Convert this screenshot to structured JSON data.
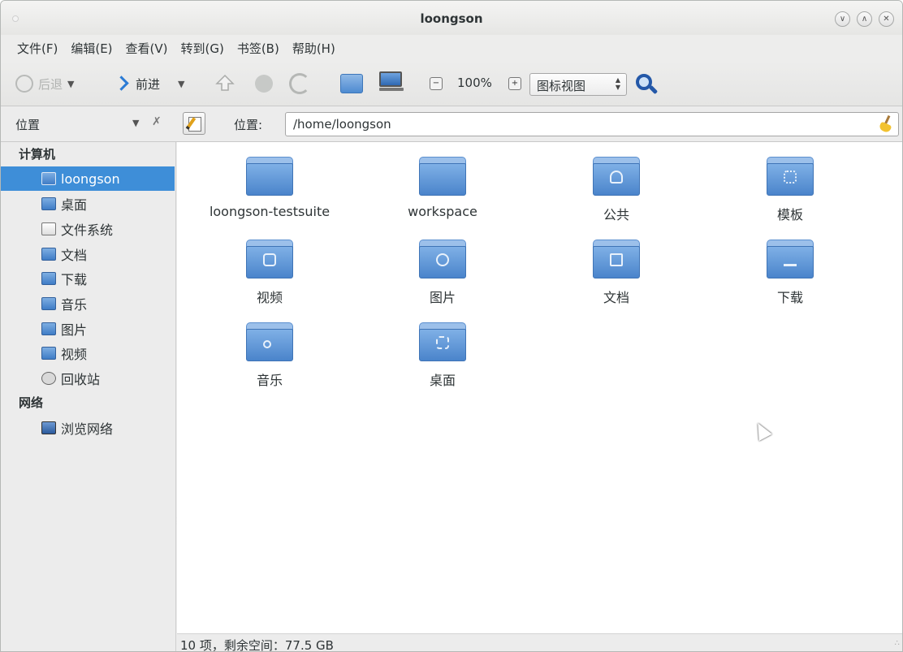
{
  "window": {
    "title": "loongson"
  },
  "menu": [
    "文件(F)",
    "编辑(E)",
    "查看(V)",
    "转到(G)",
    "书签(B)",
    "帮助(H)"
  ],
  "toolbar": {
    "back_label": "后退",
    "forward_label": "前进",
    "zoom_level": "100%",
    "view_mode": "图标视图"
  },
  "location": {
    "sidebar_header": "位置",
    "label": "位置:",
    "path": "/home/loongson"
  },
  "sidebar": {
    "section_computer": "计算机",
    "items": [
      {
        "label": "loongson",
        "icon": "home-folder-icon",
        "selected": true
      },
      {
        "label": "桌面",
        "icon": "desktop-folder-icon"
      },
      {
        "label": "文件系统",
        "icon": "filesystem-icon"
      },
      {
        "label": "文档",
        "icon": "documents-folder-icon"
      },
      {
        "label": "下载",
        "icon": "downloads-folder-icon"
      },
      {
        "label": "音乐",
        "icon": "music-folder-icon"
      },
      {
        "label": "图片",
        "icon": "pictures-folder-icon"
      },
      {
        "label": "视频",
        "icon": "videos-folder-icon"
      },
      {
        "label": "回收站",
        "icon": "trash-icon"
      }
    ],
    "section_network": "网络",
    "network_items": [
      {
        "label": "浏览网络",
        "icon": "network-icon"
      }
    ]
  },
  "files": [
    {
      "name": "loongson-testsuite",
      "icon": "folder-icon"
    },
    {
      "name": "workspace",
      "icon": "folder-icon"
    },
    {
      "name": "公共",
      "icon": "public-folder-icon"
    },
    {
      "name": "模板",
      "icon": "templates-folder-icon"
    },
    {
      "name": "视频",
      "icon": "videos-folder-icon"
    },
    {
      "name": "图片",
      "icon": "pictures-folder-icon"
    },
    {
      "name": "文档",
      "icon": "documents-folder-icon"
    },
    {
      "name": "下载",
      "icon": "downloads-folder-icon"
    },
    {
      "name": "音乐",
      "icon": "music-folder-icon"
    },
    {
      "name": "桌面",
      "icon": "desktop-folder-icon"
    }
  ],
  "status": {
    "text": "10 项，剩余空间：77.5 GB"
  },
  "colors": {
    "selection": "#3e8ed8",
    "folder": "#5b95d8"
  }
}
